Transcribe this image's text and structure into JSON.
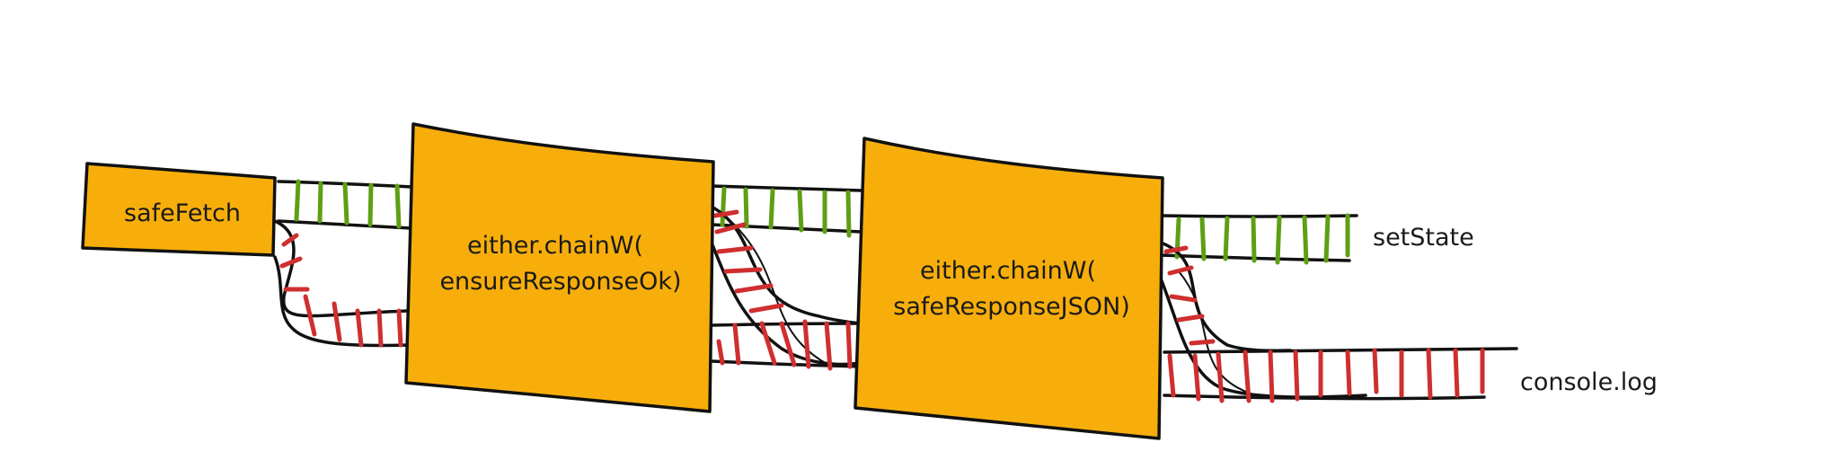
{
  "colors": {
    "box_fill": "#F7AE0A",
    "success_ticks": "#5E9F14",
    "error_ticks": "#CF2F2F",
    "outline": "#111111"
  },
  "nodes": {
    "safe_fetch": {
      "label": "safeFetch"
    },
    "chain_ok": {
      "line1": "either.chainW(",
      "line2": "ensureResponseOk)"
    },
    "chain_json": {
      "line1": "either.chainW(",
      "line2": "safeResponseJSON)"
    }
  },
  "outputs": {
    "success": "setState",
    "failure": "console.log"
  }
}
